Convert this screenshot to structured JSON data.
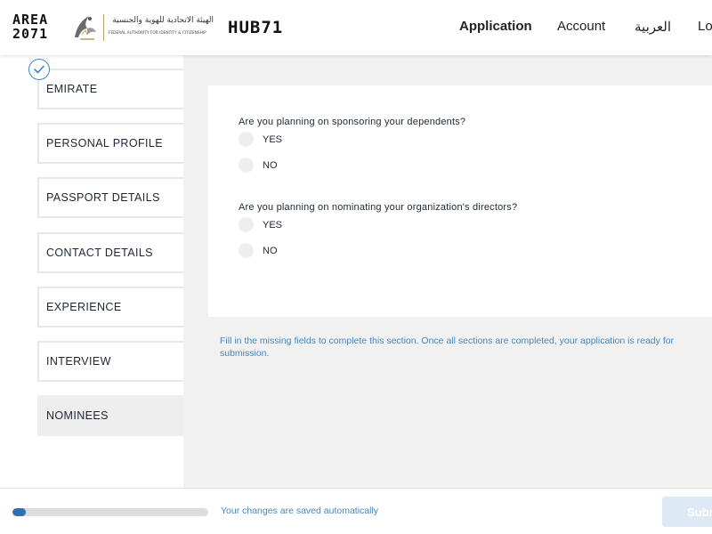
{
  "header": {
    "area_logo": {
      "line1": "AREA",
      "line2": "2071"
    },
    "authority_logo": {
      "arabic": "الهيئة الاتحادية للهوية والجنسية",
      "english": "FEDERAL AUTHORITY FOR IDENTITY & CITIZENSHIP"
    },
    "hub_logo": "HUB71",
    "nav": [
      {
        "label": "Application",
        "active": true
      },
      {
        "label": "Account",
        "active": false
      },
      {
        "label": "العربية",
        "active": false
      },
      {
        "label": "Lo",
        "active": false
      }
    ]
  },
  "sidebar": {
    "completed_icon": "check-icon",
    "steps": [
      {
        "label": "EMIRATE",
        "completed": true
      },
      {
        "label": "PERSONAL PROFILE"
      },
      {
        "label": "PASSPORT DETAILS"
      },
      {
        "label": "CONTACT DETAILS"
      },
      {
        "label": "EXPERIENCE"
      },
      {
        "label": "INTERVIEW"
      },
      {
        "label": "NOMINEES",
        "active": true
      }
    ]
  },
  "form": {
    "questions": [
      {
        "text": "Are you planning on sponsoring your dependents?",
        "options": [
          "YES",
          "NO"
        ]
      },
      {
        "text": "Are you planning on nominating your organization's directors?",
        "options": [
          "YES",
          "NO"
        ]
      }
    ],
    "hint": "Fill in the missing fields to complete this section. Once all sections are completed, your application is ready for submission."
  },
  "footer": {
    "progress_fraction": 0.07,
    "save_note": "Your changes are saved automatically",
    "submit_label": "Subm"
  },
  "colors": {
    "accent": "#2e6fb5",
    "hint_text": "#4a86b8",
    "main_bg": "#f1f1f1",
    "submit_bg": "#dde9f4"
  }
}
